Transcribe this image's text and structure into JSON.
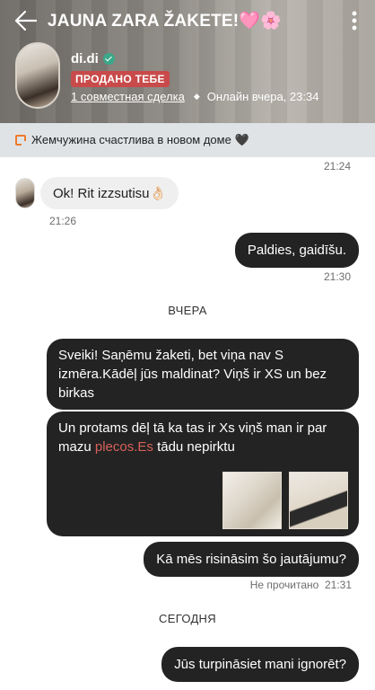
{
  "header": {
    "title": "JAUNA ZARA ŽAKETE!🩷🌸",
    "username": "di.di",
    "sold_badge": "ПРОДАНО ТЕБЕ",
    "deal_link": "1 совместная сделка",
    "online_status": "Онлайн вчера, 23:34"
  },
  "notice": {
    "text": "Жемчужина счастлива в новом доме 🖤"
  },
  "messages": {
    "t_2124": "21:24",
    "in1_text": "Ok! Rit izzsutisu👌🏻",
    "in1_time": "21:26",
    "out1_text": "Paldies, gaidīšu.",
    "out1_time": "21:30",
    "day1": "ВЧЕРА",
    "out2_text": "Sveiki! Saņēmu žaketi, bet viņa nav S izmēra.Kādēļ jūs maldinat? Viņš ir XS un bez birkas",
    "out3_text_a": "Un protams dēļ tā ka tas ir Xs viņš man ir par mazu ",
    "out3_link": "plecos.Es",
    "out3_text_b": " tādu nepirktu",
    "out4_text": "Kā mēs risināsim šo jautājumu?",
    "out4_status": "Не прочитано",
    "out4_time": "21:31",
    "day2": "СЕГОДНЯ",
    "out5_text": "Jūs turpināsiet mani ignorēt?"
  }
}
